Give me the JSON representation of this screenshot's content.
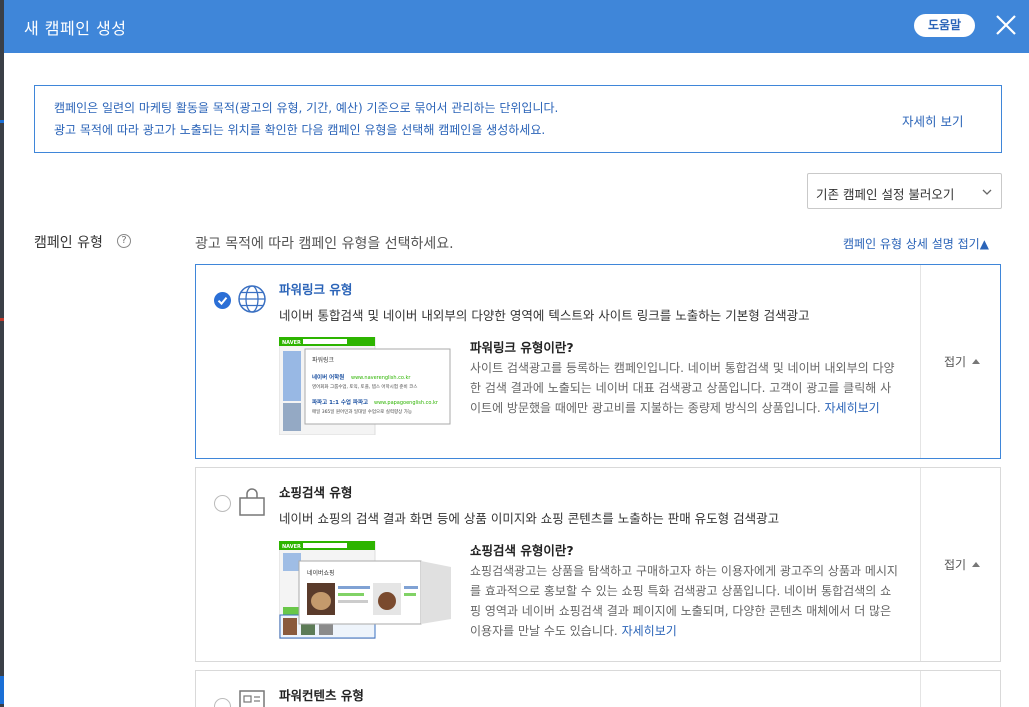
{
  "modal": {
    "title": "새 캠페인 생성",
    "help_label": "도움말"
  },
  "info": {
    "line1": "캠페인은 일련의 마케팅 활동을 목적(광고의 유형, 기간, 예산) 기준으로 묶어서 관리하는 단위입니다.",
    "line2": "광고 목적에 따라 광고가 노출되는 위치를 확인한 다음 캠페인 유형을 선택해 캠페인을 생성하세요.",
    "more_label": "자세히 보기"
  },
  "load_settings": {
    "label": "기존 캠페인 설정 불러오기"
  },
  "campaign_type": {
    "label": "캠페인 유형",
    "help_mark": "?",
    "description": "광고 목적에 따라 캠페인 유형을 선택하세요.",
    "detail_toggle": "캠페인 유형 상세 설명 접기▲"
  },
  "cards": [
    {
      "title": "파워링크 유형",
      "subtitle": "네이버 통합검색 및 네이버 내외부의 다양한 영역에 텍스트와 사이트 링크를 노출하는 기본형 검색광고",
      "what_title": "파워링크 유형이란?",
      "what_body": "사이트 검색광고를 등록하는 캠페인입니다. 네이버 통합검색 및 네이버 내외부의 다양한 검색 결과에 노출되는 네이버 대표 검색광고 상품입니다. 고객이 광고를 클릭해 사이트에 방문했을 때에만 광고비를 지불하는 종량제 방식의 상품입니다.",
      "more_label": "자세히보기",
      "fold_label": "접기",
      "selected": true,
      "icon": "globe-icon",
      "thumb": {
        "brand": "NAVER",
        "popup_title": "파워링크",
        "ad1_name": "네이버 어학원",
        "ad1_url": "www.naverenglish.co.kr",
        "ad1_desc": "영어회화 그룹수업, 토익, 토플, 텝스 어학시험 준비 코스",
        "ad2_name": "파파고 1:1 수업 파파고",
        "ad2_url": "www.papagoenglish.co.kr",
        "ad2_desc": "매일 365일 원어민과 일대일 수업으로 실력향상 가능"
      }
    },
    {
      "title": "쇼핑검색 유형",
      "subtitle": "네이버 쇼핑의 검색 결과 화면 등에 상품 이미지와 쇼핑 콘텐츠를 노출하는 판매 유도형 검색광고",
      "what_title": "쇼핑검색 유형이란?",
      "what_body": "쇼핑검색광고는 상품을 탐색하고 구매하고자 하는 이용자에게 광고주의 상품과 메시지를 효과적으로 홍보할 수 있는 쇼핑 특화 검색광고 상품입니다. 네이버 통합검색의 쇼핑 영역과 네이버 쇼핑검색 결과 페이지에 노출되며, 다양한 콘텐츠 매체에서 더 많은 이용자를 만날 수도 있습니다.",
      "more_label": "자세히보기",
      "fold_label": "접기",
      "selected": false,
      "icon": "shopping-bag-icon",
      "thumb": {
        "brand": "NAVER",
        "popup_title": "네이버쇼핑"
      }
    },
    {
      "title": "파워컨텐츠 유형",
      "selected": false,
      "icon": "content-doc-icon"
    }
  ],
  "colors": {
    "header": "#3f86d9",
    "accent": "#2b64b8",
    "radio_on": "#2b6fd6",
    "naver_green": "#2db400"
  }
}
